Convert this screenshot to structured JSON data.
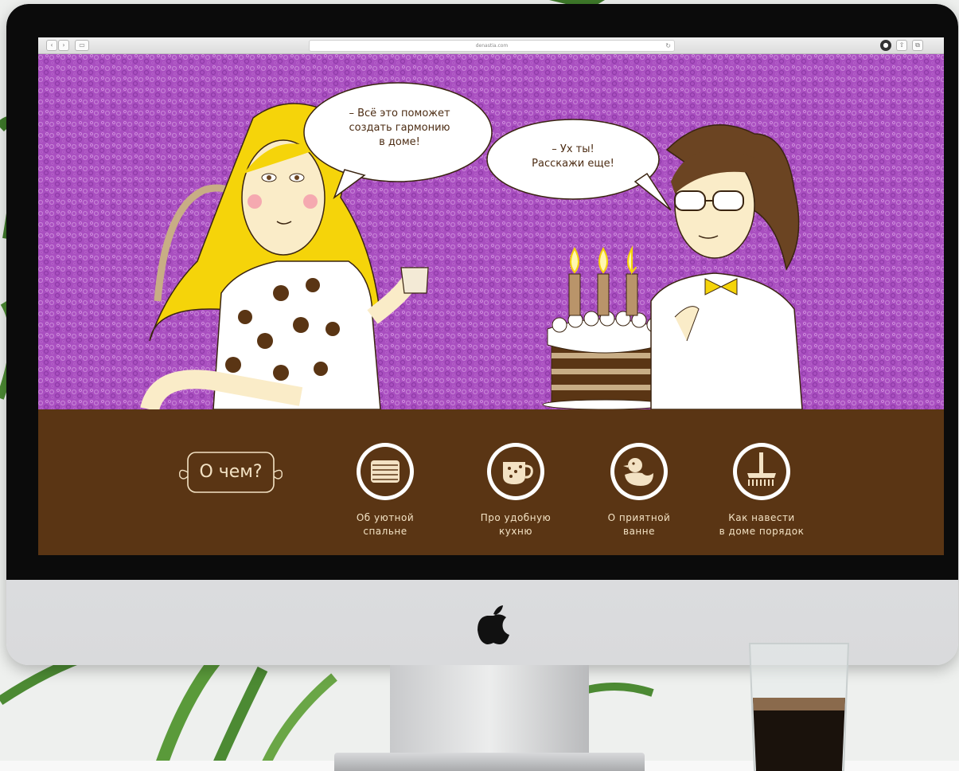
{
  "browser": {
    "url": "denastia.com",
    "back_icon": "chevron-left-icon",
    "forward_icon": "chevron-right-icon",
    "sidebar_icon": "sidebar-icon",
    "reload_icon": "reload-icon",
    "share_icon": "share-icon",
    "tabs_icon": "tabs-icon",
    "info_icon": "info-icon"
  },
  "hero": {
    "bubble_left": "– Всё это поможет\nсоздать гармонию\nв доме!",
    "bubble_right": "– Ух ты!\nРасскажи еще!"
  },
  "footer": {
    "about_label": "О чем?",
    "nav": [
      {
        "label": "Об уютной\nспальне",
        "icon": "pillow-icon"
      },
      {
        "label": "Про удобную\nкухню",
        "icon": "cup-icon"
      },
      {
        "label": "О приятной\nванне",
        "icon": "duck-icon"
      },
      {
        "label": "Как навести\nв доме порядок",
        "icon": "broom-icon"
      }
    ]
  },
  "colors": {
    "hero_purple": "#a94fc0",
    "band_brown": "#5a3514",
    "text_cream": "#f3e2c4",
    "hair_yellow": "#f5d40a"
  }
}
